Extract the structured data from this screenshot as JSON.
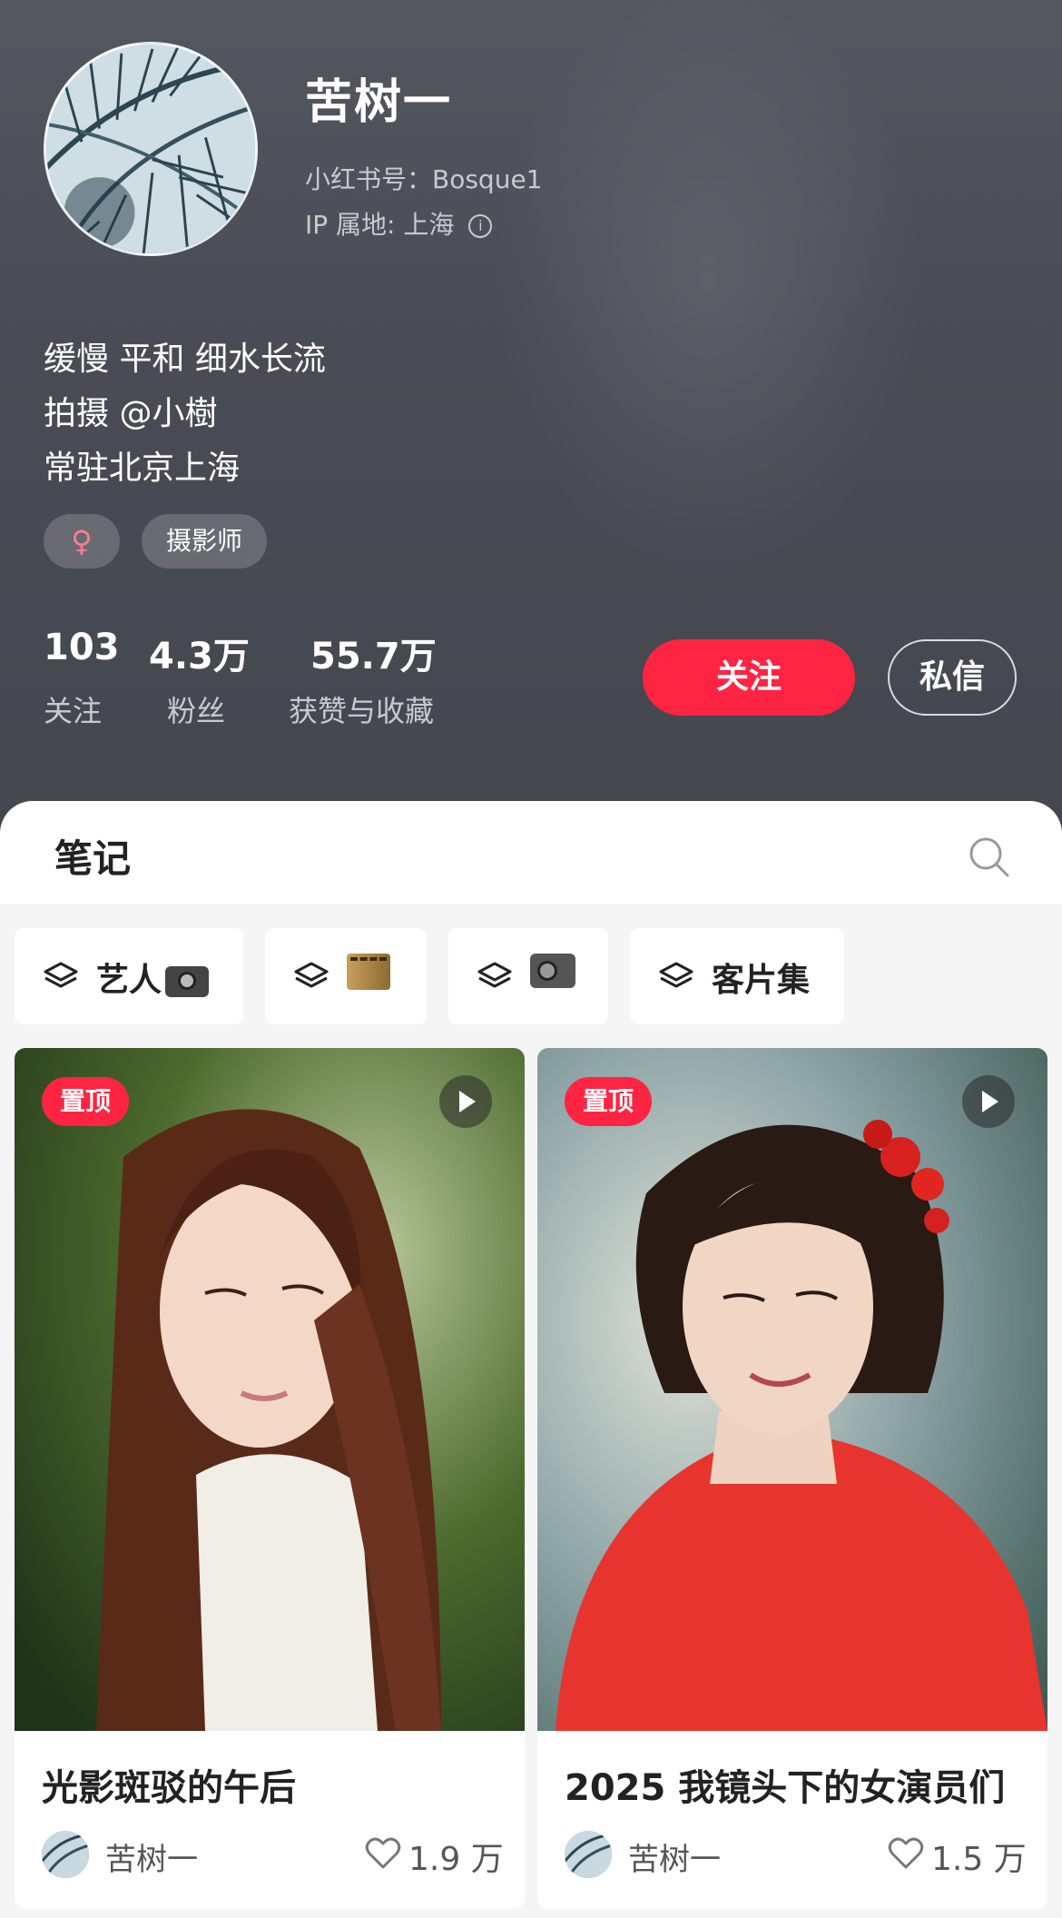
{
  "profile": {
    "name": "苦树一",
    "account_id": "小红书号：Bosque1",
    "ip_location": "IP 属地: 上海",
    "bio": [
      "缓慢 平和 细水长流",
      "拍摄 @小樹",
      "常驻北京上海"
    ],
    "tags": [
      "♀",
      "摄影师"
    ]
  },
  "stats": [
    {
      "value": "103",
      "label": "关注"
    },
    {
      "value": "4.3万",
      "label": "粉丝"
    },
    {
      "value": "55.7万",
      "label": "获赞与收藏"
    }
  ],
  "actions": {
    "follow": "关注",
    "message": "私信"
  },
  "notes_tab": {
    "label": "笔记"
  },
  "collections": [
    {
      "label": "艺人",
      "icon": "camera-emoji"
    },
    {
      "label": "",
      "icon": "film-emoji"
    },
    {
      "label": "",
      "icon": "video-camera-emoji"
    },
    {
      "label": "客片集",
      "icon": "layers-icon"
    }
  ],
  "posts": [
    {
      "pin": "置顶",
      "title": "光影斑驳的午后",
      "author": "苦树一",
      "likes": "1.9 万",
      "has_video": true
    },
    {
      "pin": "置顶",
      "title": "2025 我镜头下的女演员们",
      "author": "苦树一",
      "likes": "1.5 万",
      "has_video": true
    }
  ],
  "colors": {
    "accent": "#ff2442",
    "header_bg": "#4a4c55",
    "page_bg": "#f5f5f6"
  }
}
